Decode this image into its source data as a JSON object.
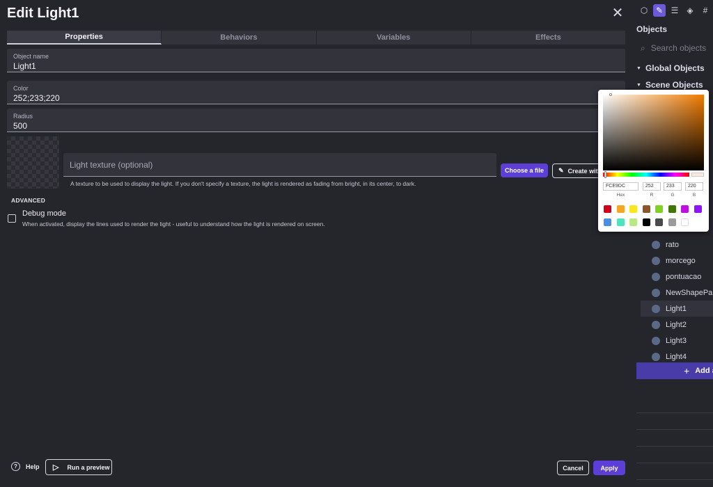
{
  "dialog": {
    "title": "Edit Light1",
    "tabs": [
      {
        "label": "Properties",
        "active": true
      },
      {
        "label": "Behaviors",
        "active": false
      },
      {
        "label": "Variables",
        "active": false
      },
      {
        "label": "Effects",
        "active": false
      }
    ],
    "fields": {
      "object_name": {
        "label": "Object name",
        "value": "Light1"
      },
      "color": {
        "label": "Color",
        "value": "252;233;220"
      },
      "radius": {
        "label": "Radius",
        "value": "500"
      }
    },
    "texture": {
      "placeholder": "Light texture (optional)",
      "help": "A texture to be used to display the light. If you don't specify a texture, the light is rendered as fading from bright, in its center, to dark.",
      "choose_label": "Choose a file",
      "create_label": "Create with"
    },
    "advanced": {
      "heading": "ADVANCED",
      "debug_title": "Debug mode",
      "debug_desc": "When activated, display the lines used to render the light - useful to understand how the light is rendered on screen."
    },
    "footer": {
      "help_label": "Help",
      "preview_label": "Run a preview",
      "cancel_label": "Cancel",
      "apply_label": "Apply"
    }
  },
  "picker": {
    "hex": "FCE9DC",
    "r": "252",
    "g": "233",
    "b": "220",
    "labels": {
      "hex": "Hex",
      "r": "R",
      "g": "G",
      "b": "B"
    },
    "current_color": "#FCE9DC",
    "swatches": [
      "#d0021b",
      "#f5a623",
      "#f8e71c",
      "#8b572a",
      "#7ed321",
      "#417505",
      "#bd10e0",
      "#9013fe",
      "#4a90e2",
      "#50e3c2",
      "#b8e986",
      "#000000",
      "#4a4a4a",
      "#9b9b9b",
      "#ffffff"
    ]
  },
  "side": {
    "title": "Objects",
    "search_placeholder": "Search objects",
    "global_label": "Global Objects",
    "scene_label": "Scene Objects",
    "objects": [
      {
        "label": "rato",
        "selected": false
      },
      {
        "label": "morcego",
        "selected": false
      },
      {
        "label": "pontuacao",
        "selected": false
      },
      {
        "label": "NewShapePainter",
        "selected": false
      },
      {
        "label": "Light1",
        "selected": true
      },
      {
        "label": "Light2",
        "selected": false
      },
      {
        "label": "Light3",
        "selected": false
      },
      {
        "label": "Light4",
        "selected": false
      }
    ],
    "add_label": "Add a new object"
  },
  "colors": {
    "accent": "#5b3fd6",
    "bg": "#25252c"
  }
}
